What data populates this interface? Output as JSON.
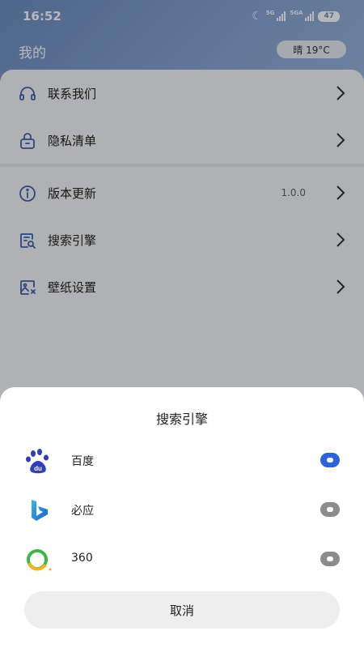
{
  "status_bar": {
    "time": "16:52",
    "net1": "5G",
    "net2": "5GA",
    "battery": "47"
  },
  "header": {
    "title": "我的",
    "weather": "晴 19°C"
  },
  "menu": {
    "contact": "联系我们",
    "privacy": "隐私清单",
    "version": "版本更新",
    "version_value": "1.0.0",
    "search_engine": "搜索引擎",
    "wallpaper": "壁纸设置"
  },
  "sheet": {
    "title": "搜索引擎",
    "options": [
      {
        "name": "百度",
        "selected": true
      },
      {
        "name": "必应",
        "selected": false
      },
      {
        "name": "360",
        "selected": false
      }
    ],
    "cancel": "取消"
  },
  "colors": {
    "accent": "#2f62d8",
    "icon": "#3f61b8"
  }
}
